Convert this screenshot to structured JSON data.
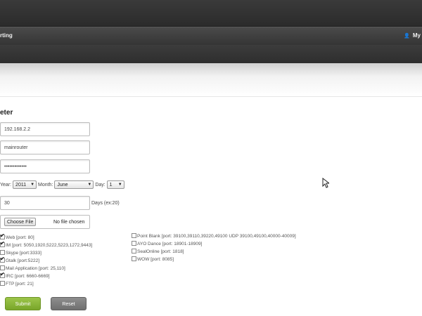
{
  "header": {
    "brand": "rting",
    "user": "My"
  },
  "form": {
    "title": "eter",
    "ip_value": "192.168.2.2",
    "name_value": "mainrouter",
    "password_value": "•••••••••••••",
    "date": {
      "year_label": "Year:",
      "year_value": "2011",
      "month_label": "Month:",
      "month_value": "June",
      "day_label": "Day:",
      "day_value": "1"
    },
    "days_value": "30",
    "days_label": "Days (ex:20)",
    "file_button": "Choose File",
    "file_status": "No file chosen"
  },
  "services_left": [
    {
      "label": "Web [port: 80]",
      "checked": true
    },
    {
      "label": "IM [port: 5050,1920,5222,5223,1272,9443]",
      "checked": true
    },
    {
      "label": "Skype [port:3333]",
      "checked": false
    },
    {
      "label": "Gtalk [port:5222]",
      "checked": true
    },
    {
      "label": "Mail Application [port: 25,110]",
      "checked": false
    },
    {
      "label": "IRC [port: 6660-6669]",
      "checked": true
    },
    {
      "label": "FTP [port: 21]",
      "checked": false
    }
  ],
  "services_right": [
    {
      "label": "Point Blank [port: 39100,39110,39220,49100 UDP 39100,49100,40000-40009]",
      "checked": false
    },
    {
      "label": "AYO Dance [port: 18901-18909]",
      "checked": false
    },
    {
      "label": "SealOnline [port: 1818]",
      "checked": false
    },
    {
      "label": "WOW [port: 8085]",
      "checked": false
    }
  ],
  "buttons": {
    "submit": "Submit",
    "reset": "Reset"
  },
  "colors": {
    "submit": "#8ab73a",
    "reset": "#7d7d7d",
    "header": "#333333"
  }
}
